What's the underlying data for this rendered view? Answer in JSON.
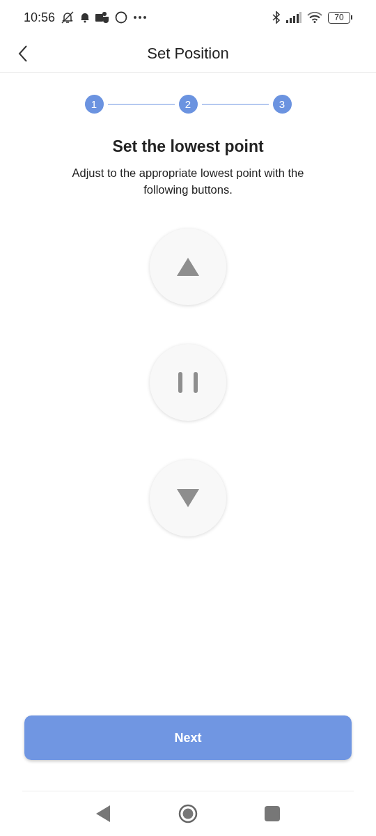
{
  "status_bar": {
    "time": "10:56",
    "battery": "70"
  },
  "header": {
    "title": "Set Position"
  },
  "steps": [
    {
      "label": "1"
    },
    {
      "label": "2"
    },
    {
      "label": "3"
    }
  ],
  "heading": "Set the lowest point",
  "description": "Adjust to the appropriate lowest point with the following buttons.",
  "controls": [
    {
      "kind": "up"
    },
    {
      "kind": "pause"
    },
    {
      "kind": "down"
    }
  ],
  "next_button": "Next"
}
